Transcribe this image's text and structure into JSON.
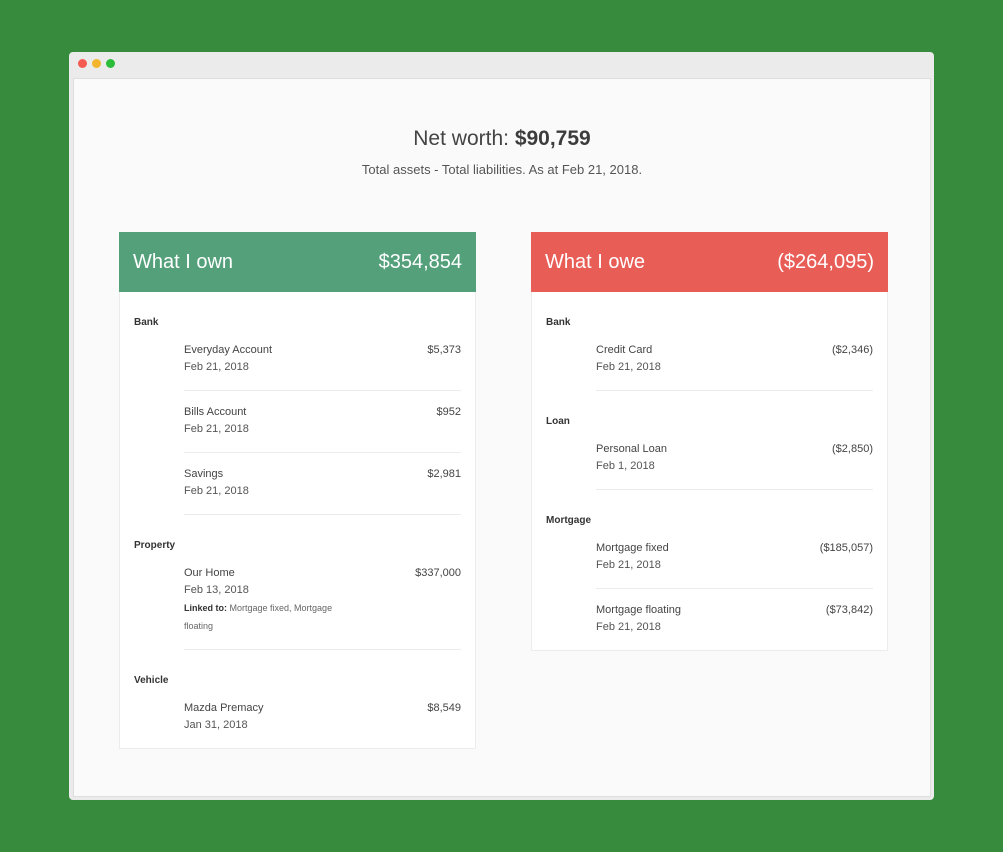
{
  "net_worth": {
    "label": "Net worth:",
    "value": "$90,759",
    "subtitle": "Total assets - Total liabilities. As at Feb 21, 2018."
  },
  "own": {
    "title": "What I own",
    "total": "$354,854",
    "groups": [
      {
        "title": "Bank",
        "items": [
          {
            "name": "Everyday Account",
            "date": "Feb 21, 2018",
            "amount": "$5,373"
          },
          {
            "name": "Bills Account",
            "date": "Feb 21, 2018",
            "amount": "$952"
          },
          {
            "name": "Savings",
            "date": "Feb 21, 2018",
            "amount": "$2,981"
          }
        ]
      },
      {
        "title": "Property",
        "items": [
          {
            "name": "Our Home",
            "date": "Feb 13, 2018",
            "amount": "$337,000",
            "linked_label": "Linked to:",
            "linked_to": "Mortgage fixed, Mortgage floating"
          }
        ]
      },
      {
        "title": "Vehicle",
        "items": [
          {
            "name": "Mazda Premacy",
            "date": "Jan 31, 2018",
            "amount": "$8,549"
          }
        ]
      }
    ]
  },
  "owe": {
    "title": "What I owe",
    "total": "($264,095)",
    "groups": [
      {
        "title": "Bank",
        "items": [
          {
            "name": "Credit Card",
            "date": "Feb 21, 2018",
            "amount": "($2,346)"
          }
        ]
      },
      {
        "title": "Loan",
        "items": [
          {
            "name": "Personal Loan",
            "date": "Feb 1, 2018",
            "amount": "($2,850)"
          }
        ]
      },
      {
        "title": "Mortgage",
        "items": [
          {
            "name": "Mortgage fixed",
            "date": "Feb 21, 2018",
            "amount": "($185,057)"
          },
          {
            "name": "Mortgage floating",
            "date": "Feb 21, 2018",
            "amount": "($73,842)"
          }
        ]
      }
    ]
  },
  "colors": {
    "background": "#378b3c",
    "own_header": "#53a07b",
    "owe_header": "#e95d57"
  }
}
